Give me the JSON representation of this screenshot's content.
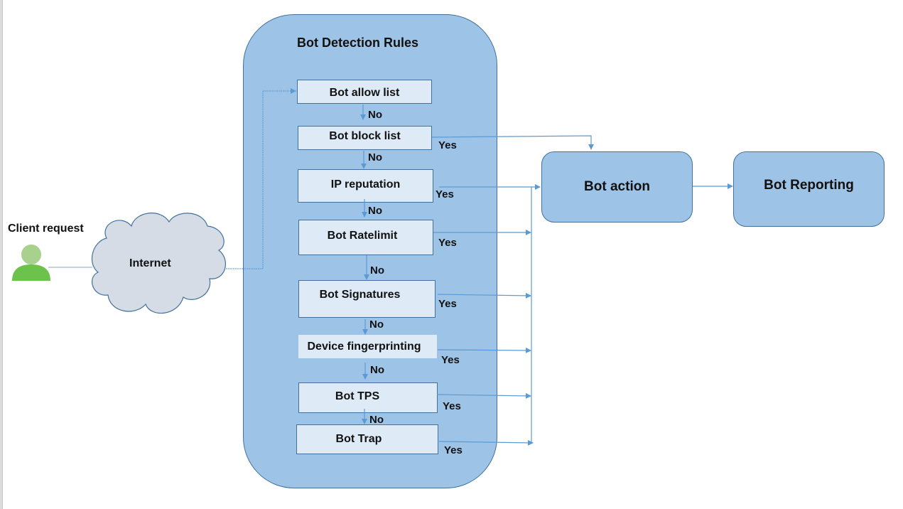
{
  "diagram": {
    "client": {
      "label": "Client request",
      "icon": "user-icon"
    },
    "internet": {
      "label": "Internet",
      "icon": "cloud-icon"
    },
    "container": {
      "title": "Bot Detection Rules"
    },
    "rules": [
      {
        "label": "Bot allow list",
        "no_label": "No",
        "yes_label": ""
      },
      {
        "label": "Bot block list",
        "no_label": "No",
        "yes_label": "Yes"
      },
      {
        "label": "IP reputation",
        "no_label": "No",
        "yes_label": "Yes"
      },
      {
        "label": "Bot Ratelimit",
        "no_label": "No",
        "yes_label": "Yes"
      },
      {
        "label": "Bot Signatures",
        "no_label": "No",
        "yes_label": "Yes"
      },
      {
        "label": "Device fingerprinting",
        "no_label": "No",
        "yes_label": "Yes"
      },
      {
        "label": "Bot TPS",
        "no_label": "No",
        "yes_label": "Yes"
      },
      {
        "label": "Bot Trap",
        "no_label": "",
        "yes_label": "Yes"
      }
    ],
    "action": {
      "label": "Bot action"
    },
    "reporting": {
      "label": "Bot Reporting"
    },
    "colors": {
      "container_fill": "#9dc3e6",
      "rule_fill": "#deebf7",
      "border": "#41719c",
      "connector": "#5b9bd5",
      "cloud_fill": "#d6dce5",
      "user_head": "#a9d18e",
      "user_body": "#70ad47"
    }
  }
}
